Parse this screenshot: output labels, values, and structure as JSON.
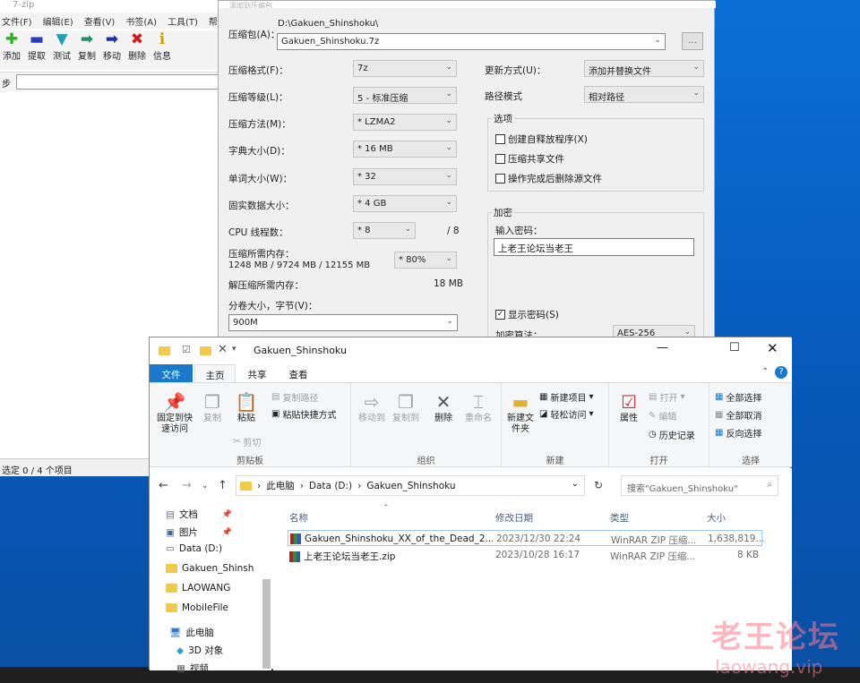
{
  "zip": {
    "title": "7-zip",
    "menu": [
      "文件(F)",
      "编辑(E)",
      "查看(V)",
      "书签(A)",
      "工具(T)",
      "帮"
    ],
    "toolbar": [
      {
        "label": "添加",
        "icon": "plus-icon"
      },
      {
        "label": "提取",
        "icon": "minus-icon"
      },
      {
        "label": "测试",
        "icon": "checkmark-icon"
      },
      {
        "label": "复制",
        "icon": "arrow-right-icon"
      },
      {
        "label": "移动",
        "icon": "arrow-right-icon"
      },
      {
        "label": "删除",
        "icon": "x-icon"
      },
      {
        "label": "信息",
        "icon": "info-icon"
      }
    ],
    "address_label": "步",
    "status": "选定 0 / 4 个项目"
  },
  "dialog": {
    "title": "添加到压缩包",
    "archive_label": "压缩包(A)：",
    "archive_path": "D:\\Gakuen_Shinshoku\\",
    "archive_name": "Gakuen_Shinshoku.7z",
    "browse": "...",
    "format_label": "压缩格式(F)：",
    "format": "7z",
    "level_label": "压缩等级(L)：",
    "level": "5 - 标准压缩",
    "method_label": "压缩方法(M)：",
    "method": "* LZMA2",
    "dict_label": "字典大小(D)：",
    "dict": "* 16 MB",
    "word_label": "单词大小(W)：",
    "word": "* 32",
    "solid_label": "固实数据大小：",
    "solid": "* 4 GB",
    "cpu_label": "CPU 线程数：",
    "cpu": "* 8",
    "cpu_max": "/ 8",
    "mem_label": "压缩所需内存：",
    "mem_values": "1248 MB / 9724 MB / 12155 MB",
    "mem_pct": "* 80%",
    "decomp_label": "解压缩所需内存：",
    "decomp": "18 MB",
    "split_label": "分卷大小，字节(V)：",
    "split": "900M",
    "update_label": "更新方式(U)：",
    "update": "添加并替换文件",
    "path_label": "路径模式",
    "path": "相对路径",
    "options_label": "选项",
    "opt_sfx": "创建自释放程序(X)",
    "opt_shared": "压缩共享文件",
    "opt_delete": "操作完成后删除源文件",
    "encrypt_label": "加密",
    "pw_label": "输入密码：",
    "pw_value": "上老王论坛当老王",
    "show_pw": "显示密码(S)",
    "enc_method_label": "加密算法：",
    "enc_method": "AES-256"
  },
  "explorer": {
    "title": "Gakuen_Shinshoku",
    "tabs": [
      "文件",
      "主页",
      "共享",
      "查看"
    ],
    "ribbon": {
      "pin": "固定到快速访问",
      "copy": "复制",
      "paste": "粘贴",
      "copy_path": "复制路径",
      "paste_shortcut": "粘贴快捷方式",
      "cut": "剪切",
      "clipboard": "剪贴板",
      "move_to": "移动到",
      "copy_to": "复制到",
      "delete": "删除",
      "rename": "重命名",
      "organize": "组织",
      "new_folder": "新建文件夹",
      "new_item": "新建项目",
      "easy_access": "轻松访问",
      "new": "新建",
      "properties": "属性",
      "open": "打开",
      "edit": "编辑",
      "history": "历史记录",
      "open_group": "打开",
      "select_all": "全部选择",
      "select_none": "全部取消",
      "invert": "反向选择",
      "select": "选择"
    },
    "breadcrumb": [
      "此电脑",
      "Data (D:)",
      "Gakuen_Shinshoku"
    ],
    "search_placeholder": "搜索\"Gakuen_Shinshoku\"",
    "sidebar": [
      "文档",
      "图片",
      "Data (D:)",
      "Gakuen_Shinsh",
      "LAOWANG",
      "MobileFile",
      "此电脑",
      "3D 对象",
      "视频"
    ],
    "columns": [
      "名称",
      "修改日期",
      "类型",
      "大小"
    ],
    "rows": [
      {
        "name": "Gakuen_Shinshoku_XX_of_the_Dead_2...",
        "date": "2023/12/30 22:24",
        "type": "WinRAR ZIP 压缩...",
        "size": "1,638,819..."
      },
      {
        "name": "上老王论坛当老王.zip",
        "date": "2023/10/28 16:17",
        "type": "WinRAR ZIP 压缩...",
        "size": "8 KB"
      }
    ]
  },
  "watermark": {
    "cn": "老王论坛",
    "url": "laowang.vip"
  }
}
